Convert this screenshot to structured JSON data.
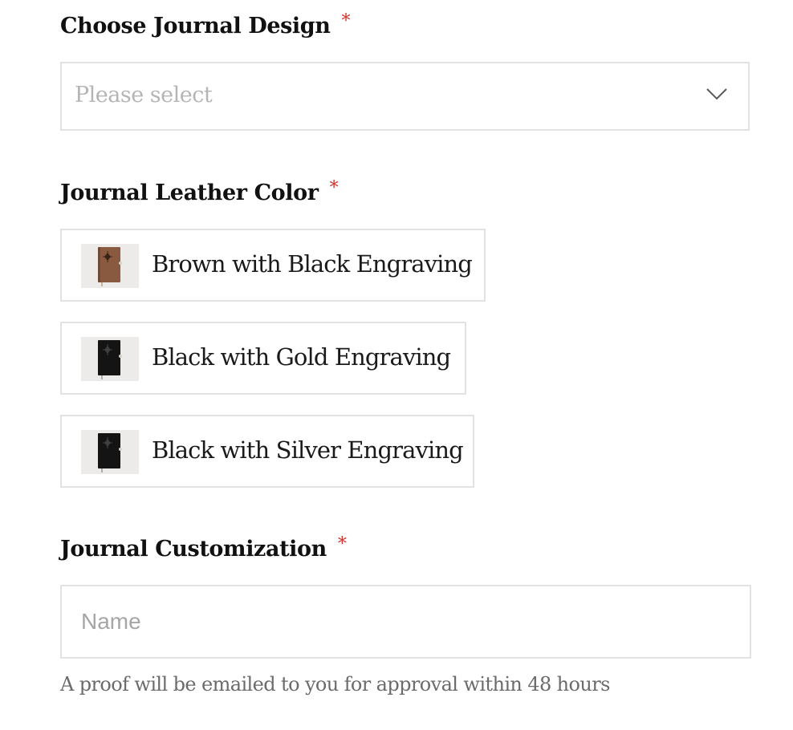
{
  "design_field": {
    "label": "Choose Journal Design",
    "required_mark": "*",
    "placeholder": "Please select",
    "icon": "chevron-down-icon"
  },
  "color_field": {
    "label": "Journal Leather Color",
    "required_mark": "*",
    "options": [
      {
        "label": "Brown with Black Engraving",
        "thumb_color": "#8a5a40"
      },
      {
        "label": "Black with Gold Engraving",
        "thumb_color": "#141414"
      },
      {
        "label": "Black with Silver Engraving",
        "thumb_color": "#141414"
      }
    ]
  },
  "customization_field": {
    "label": "Journal Customization",
    "required_mark": "*",
    "placeholder": "Name",
    "value": "",
    "help_text": "A proof will be emailed to you for approval within 48 hours"
  },
  "colors": {
    "required": "#d0312d",
    "border": "#e2e2e2",
    "placeholder": "#b5b5b5",
    "help_text": "#6b6b6b"
  }
}
